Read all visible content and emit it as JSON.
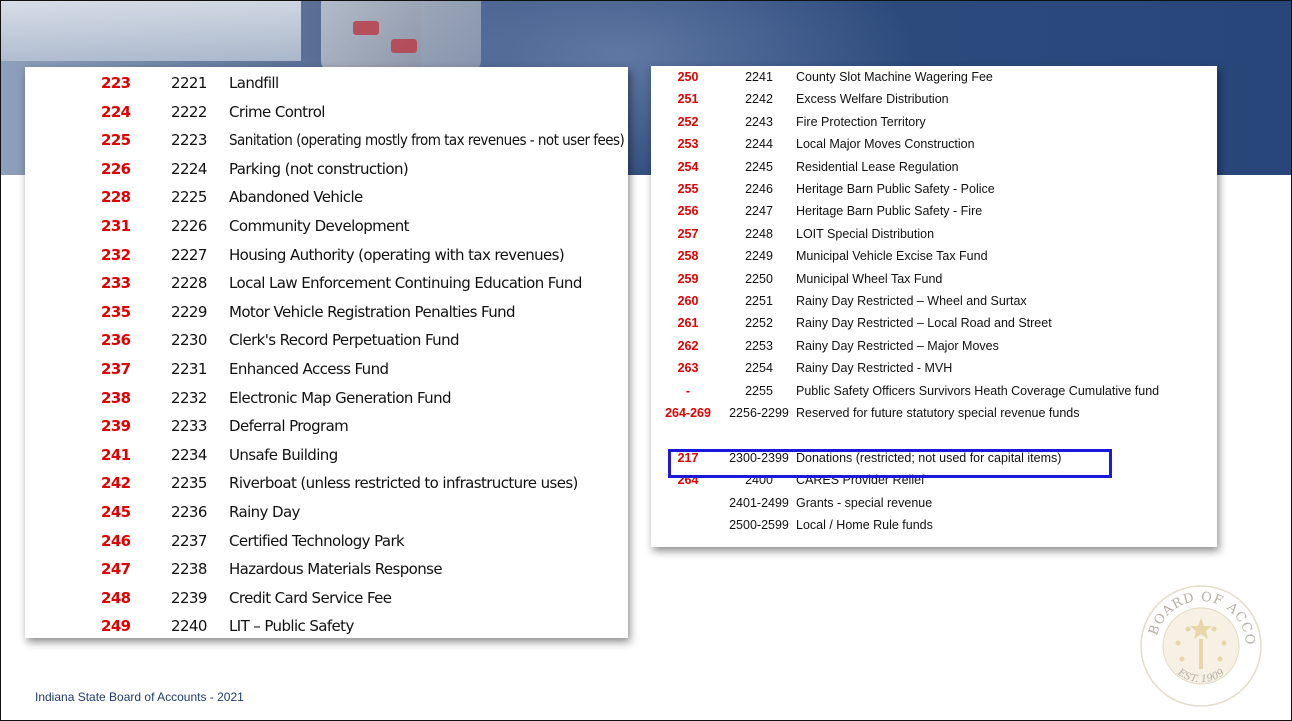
{
  "left_table": [
    {
      "old": "223",
      "new": "2221",
      "desc": "Landfill"
    },
    {
      "old": "224",
      "new": "2222",
      "desc": "Crime Control"
    },
    {
      "old": "225",
      "new": "2223",
      "desc": "Sanitation (operating mostly from tax revenues - not user fees)"
    },
    {
      "old": "226",
      "new": "2224",
      "desc": "Parking (not construction)"
    },
    {
      "old": "228",
      "new": "2225",
      "desc": "Abandoned Vehicle"
    },
    {
      "old": "231",
      "new": "2226",
      "desc": "Community Development"
    },
    {
      "old": "232",
      "new": "2227",
      "desc": "Housing Authority (operating with tax revenues)"
    },
    {
      "old": "233",
      "new": "2228",
      "desc": "Local Law Enforcement Continuing Education Fund"
    },
    {
      "old": "235",
      "new": "2229",
      "desc": "Motor Vehicle Registration Penalties Fund"
    },
    {
      "old": "236",
      "new": "2230",
      "desc": "Clerk's Record Perpetuation Fund"
    },
    {
      "old": "237",
      "new": "2231",
      "desc": "Enhanced Access Fund"
    },
    {
      "old": "238",
      "new": "2232",
      "desc": "Electronic Map Generation Fund"
    },
    {
      "old": "239",
      "new": "2233",
      "desc": "Deferral Program"
    },
    {
      "old": "241",
      "new": "2234",
      "desc": "Unsafe Building"
    },
    {
      "old": "242",
      "new": "2235",
      "desc": "Riverboat (unless restricted to infrastructure uses)"
    },
    {
      "old": "245",
      "new": "2236",
      "desc": "Rainy Day"
    },
    {
      "old": "246",
      "new": "2237",
      "desc": "Certified Technology Park"
    },
    {
      "old": "247",
      "new": "2238",
      "desc": "Hazardous Materials Response"
    },
    {
      "old": "248",
      "new": "2239",
      "desc": "Credit Card Service Fee"
    },
    {
      "old": "249",
      "new": "2240",
      "desc": "LIT – Public Safety"
    }
  ],
  "right_table": [
    {
      "old": "250",
      "new": "2241",
      "desc": "County Slot Machine Wagering Fee"
    },
    {
      "old": "251",
      "new": "2242",
      "desc": "Excess Welfare Distribution"
    },
    {
      "old": "252",
      "new": "2243",
      "desc": "Fire Protection Territory"
    },
    {
      "old": "253",
      "new": "2244",
      "desc": "Local Major Moves Construction"
    },
    {
      "old": "254",
      "new": "2245",
      "desc": "Residential Lease Regulation"
    },
    {
      "old": "255",
      "new": "2246",
      "desc": "Heritage Barn Public Safety - Police"
    },
    {
      "old": "256",
      "new": "2247",
      "desc": "Heritage Barn Public Safety - Fire"
    },
    {
      "old": "257",
      "new": "2248",
      "desc": "LOIT Special Distribution"
    },
    {
      "old": "258",
      "new": "2249",
      "desc": "Municipal Vehicle Excise Tax Fund"
    },
    {
      "old": "259",
      "new": "2250",
      "desc": "Municipal Wheel Tax Fund"
    },
    {
      "old": "260",
      "new": "2251",
      "desc": "Rainy Day Restricted – Wheel and Surtax"
    },
    {
      "old": "261",
      "new": "2252",
      "desc": "Rainy Day Restricted – Local Road and Street"
    },
    {
      "old": "262",
      "new": "2253",
      "desc": "Rainy Day Restricted – Major Moves"
    },
    {
      "old": "263",
      "new": "2254",
      "desc": "Rainy Day Restricted - MVH"
    },
    {
      "old": "-",
      "new": "2255",
      "desc": "Public Safety Officers Survivors Heath Coverage Cumulative fund"
    },
    {
      "old": "264-269",
      "new": "2256-2299",
      "desc": "Reserved for future statutory special revenue funds"
    },
    {
      "old": "",
      "new": "",
      "desc": ""
    },
    {
      "old": "217",
      "new": "2300-2399",
      "desc": "Donations (restricted; not used for capital items)"
    },
    {
      "old": "264",
      "new": "2400",
      "desc": "CARES Provider Relief"
    },
    {
      "old": "",
      "new": "2401-2499",
      "desc": "Grants - special revenue"
    },
    {
      "old": "",
      "new": "2500-2599",
      "desc": "Local / Home Rule funds"
    }
  ],
  "footer_text": "Indiana State Board of Accounts - 2021",
  "seal": {
    "top_text": "STATE BOARD OF ACCOUNTS",
    "bottom_text": "EST. 1909"
  },
  "colors": {
    "old_code": "#e00000",
    "highlight": "#1a1adc",
    "footer": "#1f3b70"
  }
}
